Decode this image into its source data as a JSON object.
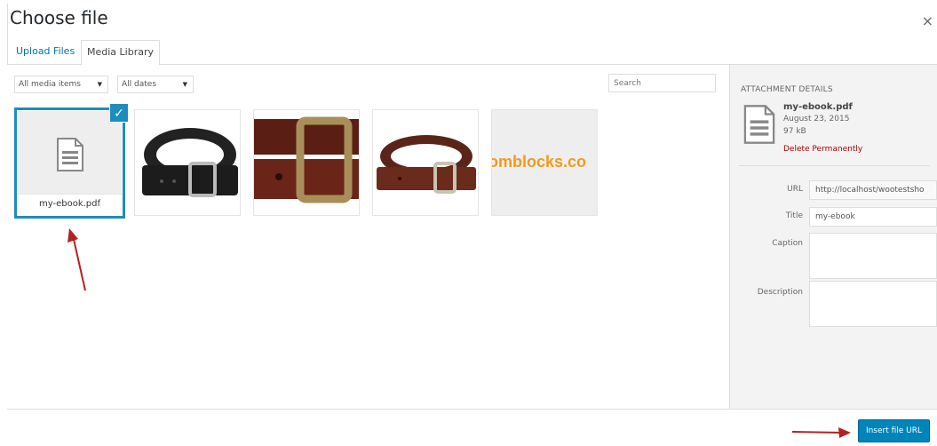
{
  "modal": {
    "title": "Choose file",
    "close_icon": "×"
  },
  "tabs": [
    {
      "label": "Upload Files",
      "active": false
    },
    {
      "label": "Media Library",
      "active": true
    }
  ],
  "filters": {
    "type": "All media items",
    "date": "All dates",
    "search_placeholder": "Search"
  },
  "media_items": [
    {
      "name": "my-ebook.pdf",
      "kind": "document",
      "selected": true
    },
    {
      "name": "black belt",
      "kind": "image",
      "selected": false
    },
    {
      "name": "brown belt buckle",
      "kind": "image",
      "selected": false
    },
    {
      "name": "brown belt",
      "kind": "image",
      "selected": false
    },
    {
      "name": "logo",
      "kind": "image",
      "logo_text": "omblocks.co",
      "selected": false
    }
  ],
  "details": {
    "heading": "ATTACHMENT DETAILS",
    "filename": "my-ebook.pdf",
    "date": "August 23, 2015",
    "size": "97 kB",
    "delete_label": "Delete Permanently",
    "url_label": "URL",
    "url_value": "http://localhost/wootestsho",
    "title_label": "Title",
    "title_value": "my-ebook",
    "caption_label": "Caption",
    "description_label": "Description"
  },
  "footer": {
    "insert_label": "Insert file URL"
  },
  "colors": {
    "accent": "#1e8cbe",
    "button": "#0085ba",
    "delete": "#aa0000",
    "arrow": "#b22222"
  }
}
